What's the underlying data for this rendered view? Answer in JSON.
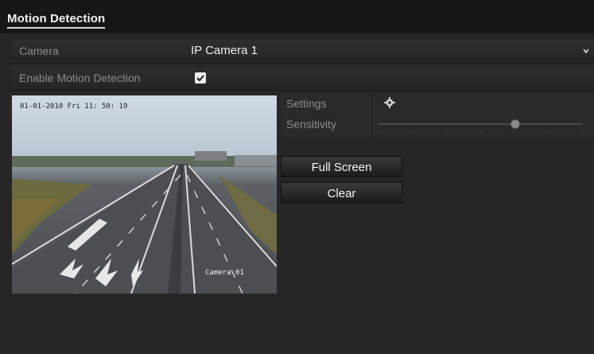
{
  "page": {
    "title": "Motion Detection"
  },
  "form": {
    "camera_label": "Camera",
    "camera_value": "IP Camera 1",
    "enable_label": "Enable Motion Detection",
    "enable_checked": true
  },
  "video": {
    "timestamp": "01-01-2010 Fri 11: 50: 19",
    "camera_osd": "Camera 01"
  },
  "settings": {
    "settings_label": "Settings",
    "sensitivity_label": "Sensitivity",
    "sensitivity_level": 0.67
  },
  "buttons": {
    "full_screen": "Full Screen",
    "clear": "Clear"
  },
  "colors": {
    "background": "#262626",
    "topbar": "#161616",
    "label_gray": "#8c8c8c"
  }
}
